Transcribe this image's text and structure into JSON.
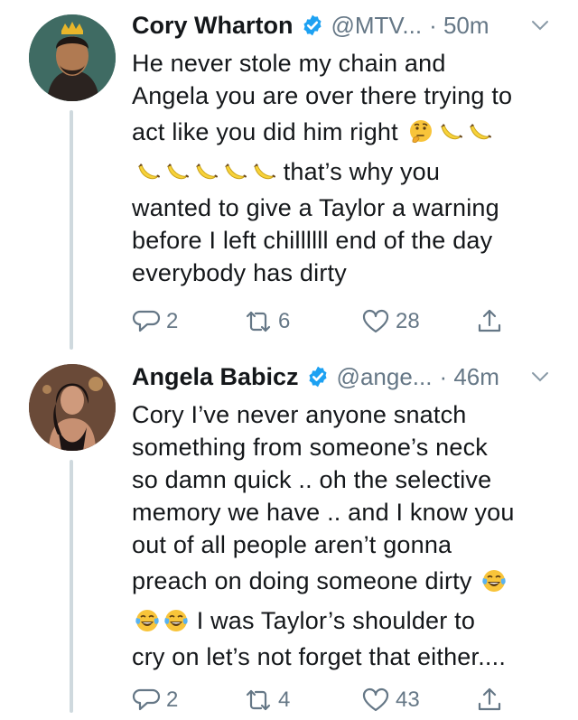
{
  "tweets": [
    {
      "name": "Cory Wharton",
      "handle": "@MTV...",
      "time": "· 50m",
      "lines": [
        "He never stole my chain and",
        "Angela you are over there trying to",
        "act like you did him right",
        "that’s why you",
        "wanted to give a Taylor a warning",
        "before I left chillllll end of the day",
        "everybody has dirty"
      ],
      "replies": "2",
      "retweets": "6",
      "likes": "28"
    },
    {
      "name": "Angela Babicz",
      "handle": "@ange...",
      "time": "· 46m",
      "lines": [
        "Cory I’ve never anyone snatch",
        "something from someone’s neck",
        "so damn quick .. oh the selective",
        "memory we have .. and I know you",
        "out of all people aren’t gonna",
        "preach on doing someone dirty",
        "I was Taylor’s shoulder to",
        "cry on let’s not forget that either...."
      ],
      "replies": "2",
      "retweets": "4",
      "likes": "43"
    }
  ],
  "colors": {
    "text": "#14171a",
    "secondary": "#657786",
    "verified": "#1da1f2",
    "thread_line": "#cfd9de"
  },
  "icons": {
    "verified": "verified-badge-icon",
    "reply": "reply-icon",
    "retweet": "retweet-icon",
    "like": "heart-icon",
    "share": "share-icon",
    "more": "chevron-down-icon",
    "emoji_thinking": "thinking-face-emoji",
    "emoji_banana": "banana-emoji",
    "emoji_laugh": "tears-of-joy-emoji"
  }
}
